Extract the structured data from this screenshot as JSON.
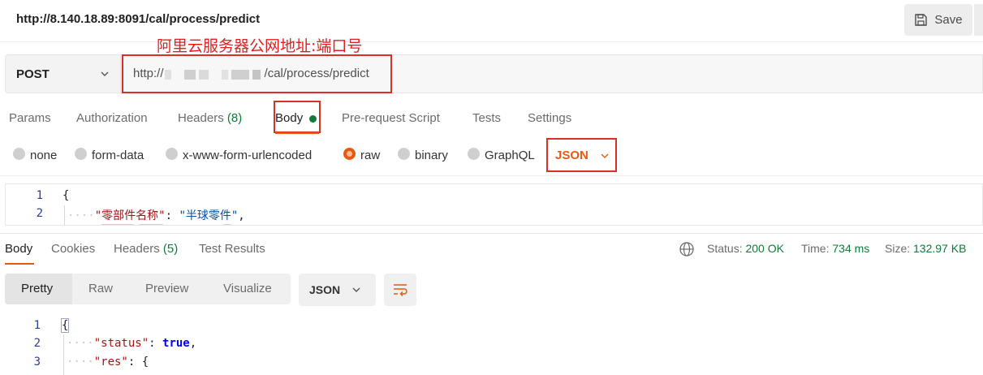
{
  "request": {
    "title": "http://8.140.18.89:8091/cal/process/predict",
    "save_label": "Save",
    "method": "POST",
    "url_prefix": "http://",
    "url_suffix": "/cal/process/predict"
  },
  "annotation": "阿里云服务器公网地址:端口号",
  "request_tabs": {
    "params": "Params",
    "authorization": "Authorization",
    "headers": "Headers",
    "headers_count": "(8)",
    "body": "Body",
    "prerequest": "Pre-request Script",
    "tests": "Tests",
    "settings": "Settings"
  },
  "body_types": {
    "none": "none",
    "form_data": "form-data",
    "urlencoded": "x-www-form-urlencoded",
    "raw": "raw",
    "binary": "binary",
    "graphql": "GraphQL",
    "selected": "raw",
    "raw_format": "JSON"
  },
  "request_body": {
    "line_numbers": [
      "1",
      "2"
    ],
    "line1": "{",
    "line2_key": "\"零部件名称\"",
    "line2_sep": ": ",
    "line2_val": "\"半球零件\"",
    "line2_end": ","
  },
  "response_tabs": {
    "body": "Body",
    "cookies": "Cookies",
    "headers": "Headers",
    "headers_count": "(5)",
    "test_results": "Test Results"
  },
  "response_status": {
    "status_label": "Status:",
    "status_value": "200 OK",
    "time_label": "Time:",
    "time_value": "734 ms",
    "size_label": "Size:",
    "size_value": "132.97 KB"
  },
  "response_view": {
    "pretty": "Pretty",
    "raw": "Raw",
    "preview": "Preview",
    "visualize": "Visualize",
    "format": "JSON",
    "active": "Pretty"
  },
  "response_body": {
    "line_numbers": [
      "1",
      "2",
      "3"
    ],
    "line1": "{",
    "line2_key": "\"status\"",
    "line2_sep": ": ",
    "line2_val": "true",
    "line2_end": ",",
    "line3_key": "\"res\"",
    "line3_sep": ": ",
    "line3_val": "{"
  },
  "colors": {
    "accent": "#e8590c",
    "annotation_red": "#d93025",
    "success_green": "#0f7b36"
  }
}
